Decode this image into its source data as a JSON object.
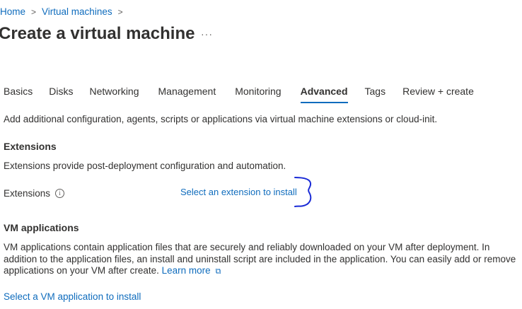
{
  "breadcrumb": {
    "items": [
      {
        "label": "Home"
      },
      {
        "label": "Virtual machines"
      }
    ],
    "separator": ">"
  },
  "header": {
    "title": "Create a virtual machine",
    "more_label": "···"
  },
  "tabs": [
    {
      "label": "Basics",
      "active": false
    },
    {
      "label": "Disks",
      "active": false
    },
    {
      "label": "Networking",
      "active": false
    },
    {
      "label": "Management",
      "active": false
    },
    {
      "label": "Monitoring",
      "active": false
    },
    {
      "label": "Advanced",
      "active": true
    },
    {
      "label": "Tags",
      "active": false
    },
    {
      "label": "Review + create",
      "active": false
    }
  ],
  "intro": "Add additional configuration, agents, scripts or applications via virtual machine extensions or cloud-init.",
  "extensions": {
    "title": "Extensions",
    "description": "Extensions provide post-deployment configuration and automation.",
    "field_label": "Extensions",
    "info_icon": "info-icon",
    "link": "Select an extension to install"
  },
  "vm_applications": {
    "title": "VM applications",
    "description": "VM applications contain application files that are securely and reliably downloaded on your VM after deployment. In addition to the application files, an install and uninstall script are included in the application. You can easily add or remove applications on your VM after create.",
    "learn_more": "Learn more",
    "external_icon": "external-link-icon",
    "link": "Select a VM application to install"
  },
  "colors": {
    "link": "#0f6cbd",
    "text": "#323130",
    "annotation": "#1a2bd6"
  }
}
